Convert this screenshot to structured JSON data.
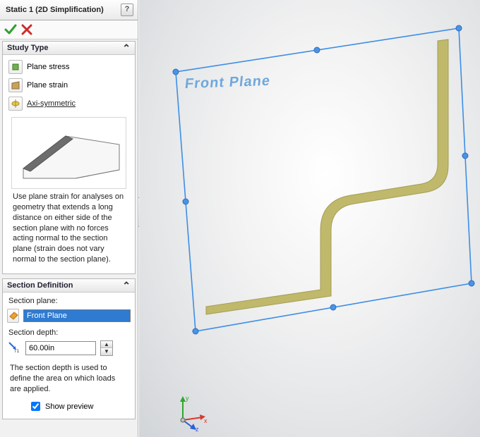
{
  "header": {
    "title": "Static 1 (2D Simplification)",
    "help_label": "?"
  },
  "study_type": {
    "title": "Study Type",
    "options": [
      {
        "label": "Plane stress",
        "icon": "plane-stress-icon"
      },
      {
        "label": "Plane strain",
        "icon": "plane-strain-icon"
      },
      {
        "label": "Axi-symmetric",
        "icon": "axisym-icon"
      }
    ],
    "selected_index": 1,
    "description": "Use plane strain for analyses on geometry that extends a long distance on either side of the section plane with no forces acting normal to the section plane (strain does not vary normal to the section plane)."
  },
  "section_definition": {
    "title": "Section Definition",
    "section_plane_label": "Section plane:",
    "section_plane_value": "Front Plane",
    "section_depth_label": "Section depth:",
    "section_depth_value": "60.00in",
    "footnote": "The section depth is used to define the area on which loads are applied.",
    "show_preview_label": "Show preview",
    "show_preview_checked": true
  },
  "viewport": {
    "plane_caption": "Front Plane",
    "triad": {
      "x": "x",
      "y": "y",
      "z": "z"
    }
  },
  "colors": {
    "selection_blue": "#2f7bd1",
    "plane_outline": "#3d8ee5",
    "handle_fill": "#4a93e7",
    "section_body": "#c0b96b"
  }
}
